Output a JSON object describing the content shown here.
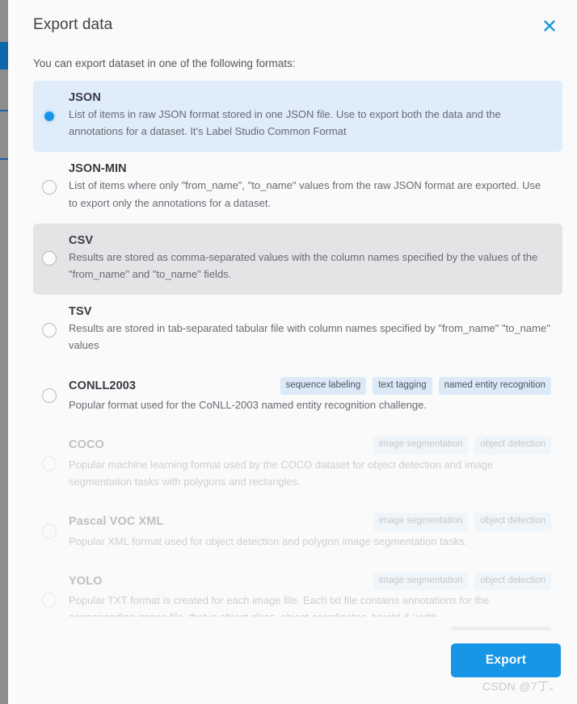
{
  "window": {
    "background": "#fafafb",
    "sidebar_accent": "#0b67a8",
    "sidebar_base": "#8d8d8d"
  },
  "dialog": {
    "title": "Export data",
    "close_icon": "close-icon",
    "subtitle": "You can export dataset in one of the following formats:",
    "accent_color": "#1795e6",
    "selected_row_bg": "#dfecf9",
    "hovered_row_bg": "#e4e4e6",
    "tag_bg": "#dbeaf6"
  },
  "formats": [
    {
      "id": "json",
      "name": "JSON",
      "description": "List of items in raw JSON format stored in one JSON file. Use to export both the data and the annotations for a dataset. It's Label Studio Common Format",
      "tags": [],
      "state": "selected",
      "checked": true,
      "disabled": false
    },
    {
      "id": "json-min",
      "name": "JSON-MIN",
      "description": "List of items where only \"from_name\", \"to_name\" values from the raw JSON format are exported. Use to export only the annotations for a dataset.",
      "tags": [],
      "state": "normal",
      "checked": false,
      "disabled": false
    },
    {
      "id": "csv",
      "name": "CSV",
      "description": "Results are stored as comma-separated values with the column names specified by the values of the \"from_name\" and \"to_name\" fields.",
      "tags": [],
      "state": "hovered",
      "checked": false,
      "disabled": false
    },
    {
      "id": "tsv",
      "name": "TSV",
      "description": "Results are stored in tab-separated tabular file with column names specified by \"from_name\" \"to_name\" values",
      "tags": [],
      "state": "normal",
      "checked": false,
      "disabled": false
    },
    {
      "id": "conll2003",
      "name": "CONLL2003",
      "description": "Popular format used for the CoNLL-2003 named entity recognition challenge.",
      "tags": [
        "sequence labeling",
        "text tagging",
        "named entity recognition"
      ],
      "state": "normal",
      "checked": false,
      "disabled": false
    },
    {
      "id": "coco",
      "name": "COCO",
      "description": "Popular machine learning format used by the COCO dataset for object detection and image segmentation tasks with polygons and rectangles.",
      "tags": [
        "image segmentation",
        "object detection"
      ],
      "state": "normal",
      "checked": false,
      "disabled": true
    },
    {
      "id": "pascal-voc-xml",
      "name": "Pascal VOC XML",
      "description": "Popular XML format used for object detection and polygon image segmentation tasks.",
      "tags": [
        "image segmentation",
        "object detection"
      ],
      "state": "normal",
      "checked": false,
      "disabled": true
    },
    {
      "id": "yolo",
      "name": "YOLO",
      "description": "Popular TXT format is created for each image file. Each txt file contains annotations for the corresponding image file, that is object class, object coordinates, height & width.",
      "tags": [
        "image segmentation",
        "object detection"
      ],
      "state": "normal",
      "checked": false,
      "disabled": true
    }
  ],
  "footer": {
    "export_label": "Export"
  },
  "watermark": {
    "text": "CSDN @7丁、"
  }
}
